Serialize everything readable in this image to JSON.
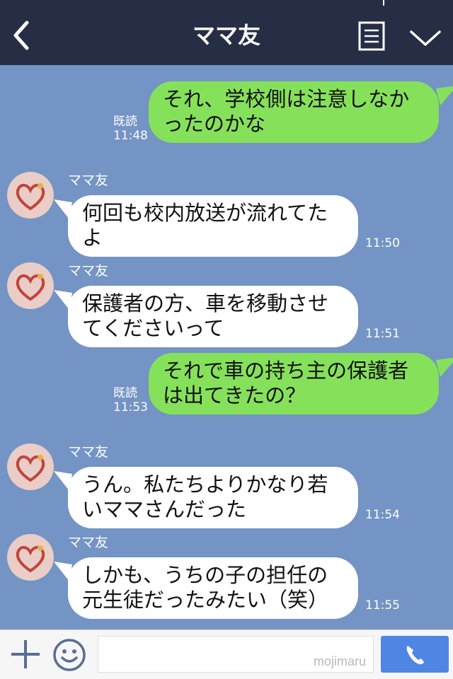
{
  "header": {
    "title": "ママ友",
    "back_icon": "chevron-left-icon",
    "menu_icon": "menu-list-icon",
    "expand_icon": "chevron-down-icon"
  },
  "colors": {
    "header_bg": "#252e45",
    "chat_bg": "#7394c4",
    "outgoing_bubble": "#86e15a",
    "incoming_bubble": "#ffffff",
    "send_button": "#4f86e4"
  },
  "messages": [
    {
      "direction": "out",
      "text1": "それ、学校側は注意しなか",
      "text2": "ったのかな",
      "read": "既読",
      "time": "11:48"
    },
    {
      "direction": "in",
      "sender": "ママ友",
      "text1": "何回も校内放送が流れてた",
      "text2": "よ",
      "time": "11:50"
    },
    {
      "direction": "in",
      "sender": "ママ友",
      "text1": "保護者の方、車を移動させ",
      "text2": "てくださいって",
      "time": "11:51"
    },
    {
      "direction": "out",
      "text1": "それで車の持ち主の保護者",
      "text2": "は出てきたの？",
      "read": "既読",
      "time": "11:53"
    },
    {
      "direction": "in",
      "sender": "ママ友",
      "text1": "うん。私たちよりかなり若",
      "text2": "いママさんだった",
      "time": "11:54"
    },
    {
      "direction": "in",
      "sender": "ママ友",
      "text1": "しかも、うちの子の担任の",
      "text2": "元生徒だったみたい（笑）",
      "time": "11:55"
    }
  ],
  "input": {
    "placeholder": "",
    "watermark": "mojimaru",
    "plus_icon": "plus-icon",
    "sticker_icon": "smiley-icon",
    "call_icon": "phone-icon"
  }
}
